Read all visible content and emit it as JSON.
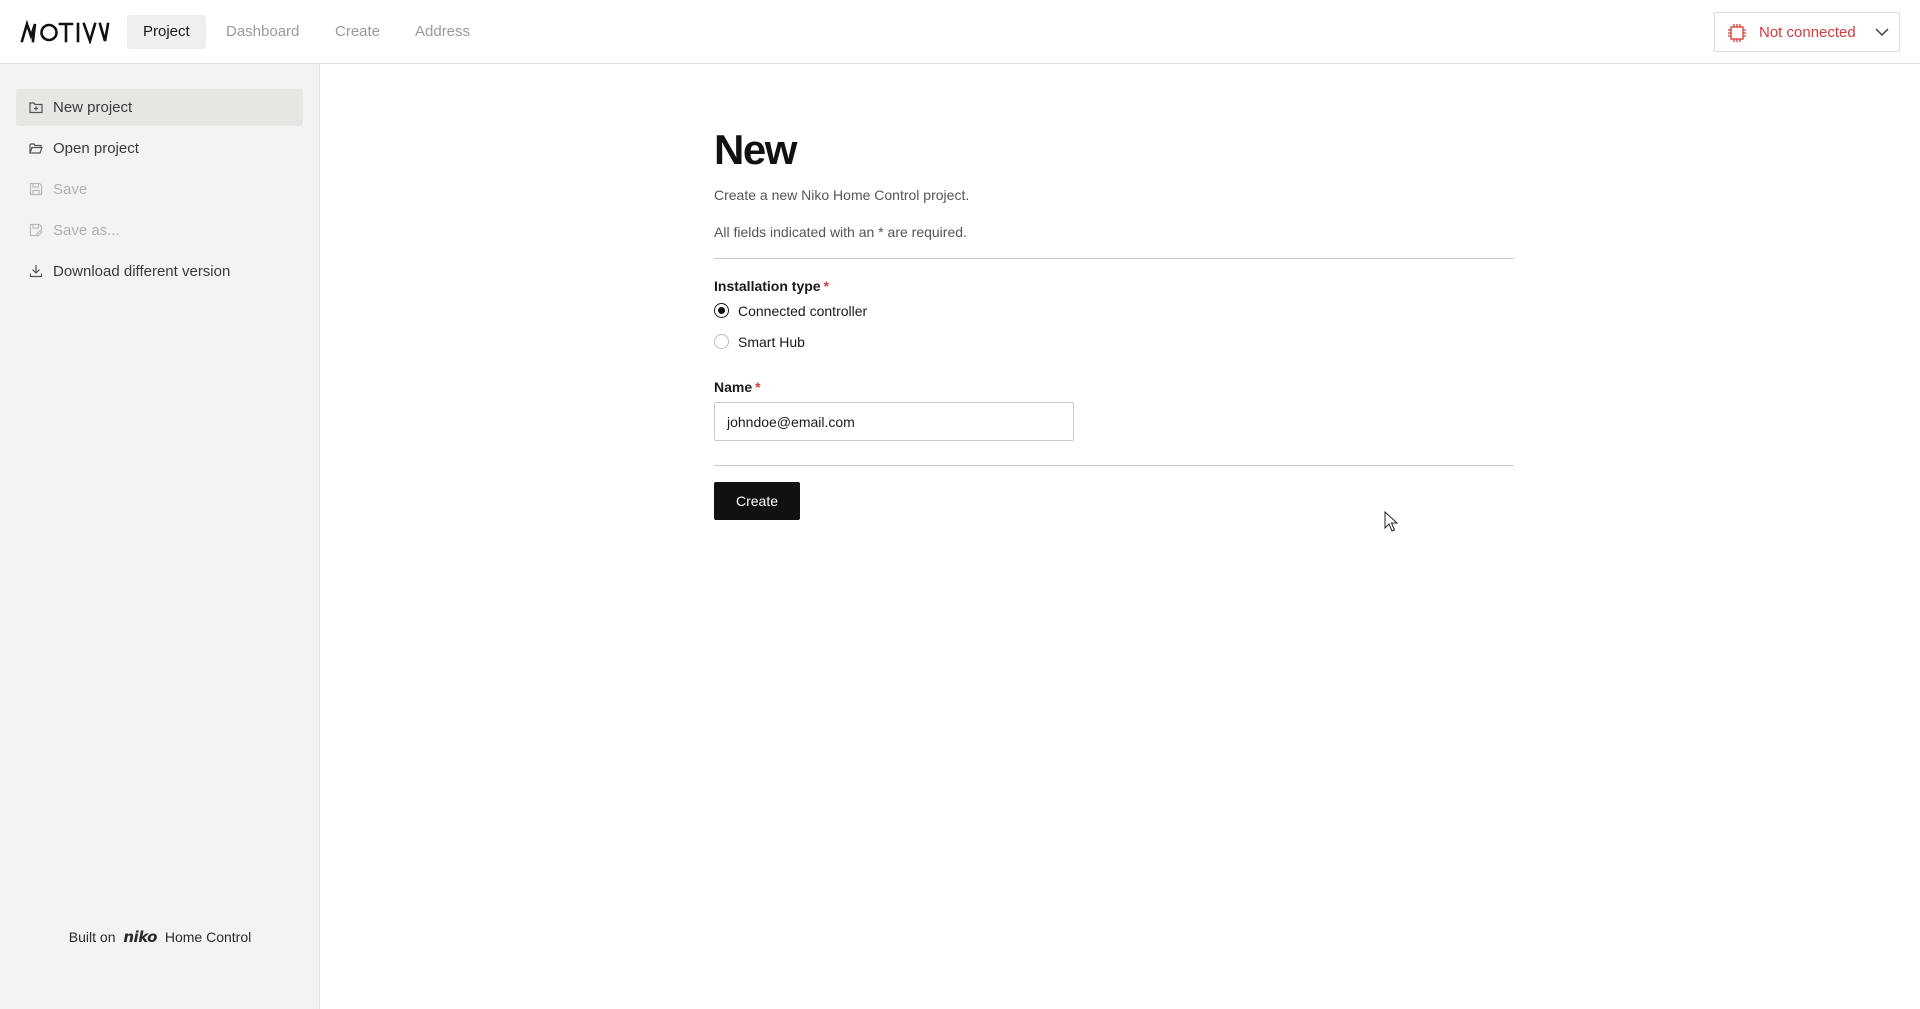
{
  "app": {
    "logo_text": "MOTIV"
  },
  "nav": {
    "tabs": [
      {
        "label": "Project",
        "active": true
      },
      {
        "label": "Dashboard",
        "active": false
      },
      {
        "label": "Create",
        "active": false
      },
      {
        "label": "Address",
        "active": false
      }
    ]
  },
  "connection": {
    "status": "Not connected",
    "icon": "chip-icon",
    "color": "#d63a3a"
  },
  "sidebar": {
    "items": [
      {
        "label": "New project",
        "icon": "folder-plus-icon",
        "active": true,
        "disabled": false
      },
      {
        "label": "Open project",
        "icon": "folder-open-icon",
        "active": false,
        "disabled": false
      },
      {
        "label": "Save",
        "icon": "save-icon",
        "active": false,
        "disabled": true
      },
      {
        "label": "Save as...",
        "icon": "save-as-icon",
        "active": false,
        "disabled": true
      },
      {
        "label": "Download different version",
        "icon": "download-icon",
        "active": false,
        "disabled": false
      }
    ],
    "footer": {
      "prefix": "Built on",
      "brand": "niko",
      "suffix": "Home Control"
    }
  },
  "main": {
    "title": "New",
    "subtitle": "Create a new Niko Home Control project.",
    "required_note": "All fields indicated with an * are required.",
    "installation_type": {
      "label": "Installation type",
      "required_marker": "*",
      "options": [
        {
          "label": "Connected controller",
          "selected": true
        },
        {
          "label": "Smart Hub",
          "selected": false
        }
      ]
    },
    "name_field": {
      "label": "Name",
      "required_marker": "*",
      "value": "johndoe@email.com"
    },
    "create_button": "Create"
  },
  "colors": {
    "accent": "#111111",
    "error": "#d63a3a",
    "sidebar_bg": "#f4f3f1"
  }
}
